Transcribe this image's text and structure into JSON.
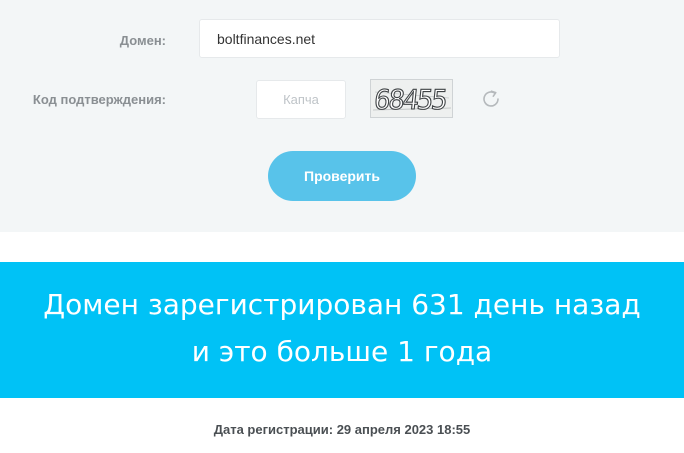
{
  "form": {
    "domain_label": "Домен:",
    "domain_value": "boltfinances.net",
    "captcha_label": "Код подтверждения:",
    "captcha_placeholder": "Капча",
    "captcha_image_text": "68455",
    "refresh_icon": "refresh-icon",
    "submit_label": "Проверить"
  },
  "result": {
    "line1": "Домен зарегистрирован 631 день назад",
    "line2": "и это больше 1 года"
  },
  "registration": {
    "text": "Дата регистрации: 29 апреля 2023 18:55"
  },
  "colors": {
    "panel_background": "#f3f6f7",
    "button": "#58c3ea",
    "banner": "#00c2f6",
    "text_white": "#ffffff"
  }
}
